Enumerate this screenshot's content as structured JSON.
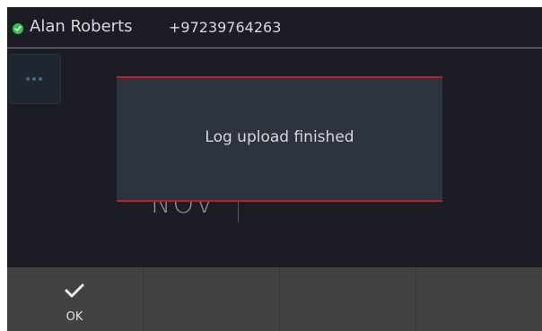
{
  "header": {
    "presence_icon": "check-circle-icon",
    "presence_color": "#37c24f",
    "user_name": "Alan Roberts",
    "user_number": "+97239764263"
  },
  "background": {
    "more_icon": "ellipsis-icon",
    "month": "NOV"
  },
  "toast": {
    "message": "Log upload finished",
    "accent_color": "#c01c2c"
  },
  "softkeys": [
    {
      "label": "OK",
      "icon": "checkmark-icon"
    },
    {
      "label": ""
    },
    {
      "label": ""
    },
    {
      "label": ""
    }
  ]
}
